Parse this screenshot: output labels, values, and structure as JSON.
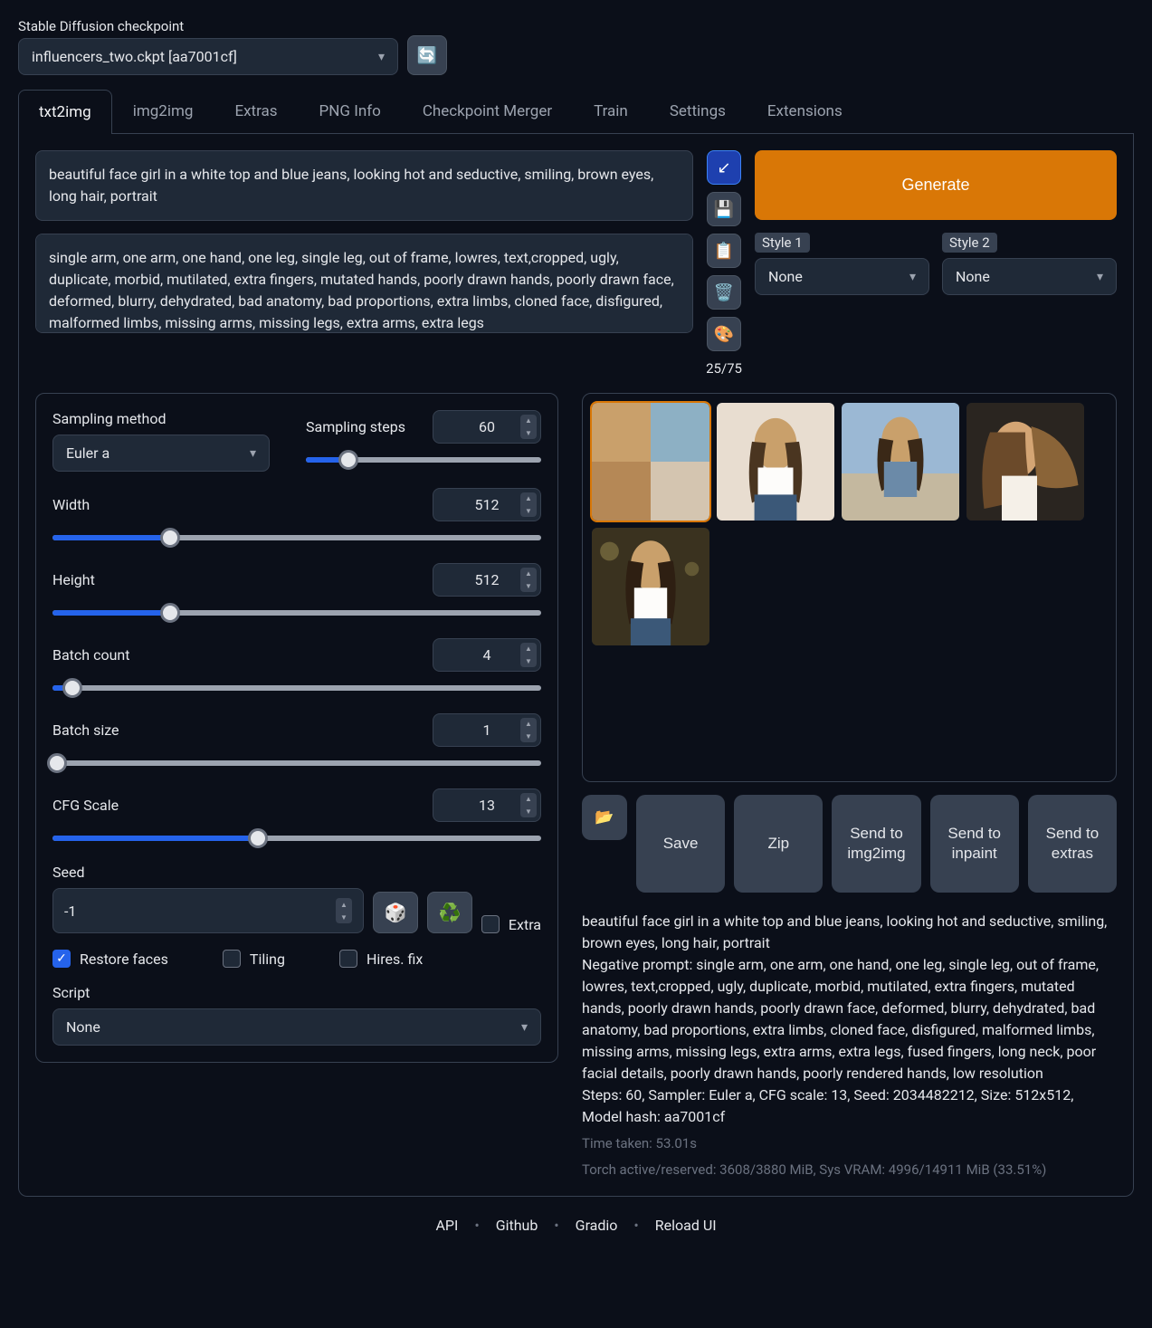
{
  "checkpoint": {
    "label": "Stable Diffusion checkpoint",
    "value": "influencers_two.ckpt [aa7001cf]"
  },
  "tabs": [
    "txt2img",
    "img2img",
    "Extras",
    "PNG Info",
    "Checkpoint Merger",
    "Train",
    "Settings",
    "Extensions"
  ],
  "prompt": "beautiful face girl in a white top and blue jeans, looking hot and seductive, smiling, brown eyes, long hair, portrait",
  "neg_prompt": "single arm, one arm, one hand, one leg, single leg, out of frame, lowres, text,cropped, ugly, duplicate, morbid, mutilated, extra fingers, mutated hands, poorly drawn hands, poorly drawn face, deformed, blurry, dehydrated, bad anatomy, bad proportions, extra limbs, cloned face, disfigured, malformed limbs, missing arms, missing legs, extra arms, extra legs",
  "token_counter": "25/75",
  "generate_label": "Generate",
  "style1": {
    "label": "Style 1",
    "value": "None"
  },
  "style2": {
    "label": "Style 2",
    "value": "None"
  },
  "sampling_method": {
    "label": "Sampling method",
    "value": "Euler a"
  },
  "sampling_steps": {
    "label": "Sampling steps",
    "value": "60",
    "fill": 18
  },
  "width": {
    "label": "Width",
    "value": "512",
    "fill": 24
  },
  "height": {
    "label": "Height",
    "value": "512",
    "fill": 24
  },
  "batch_count": {
    "label": "Batch count",
    "value": "4",
    "fill": 4
  },
  "batch_size": {
    "label": "Batch size",
    "value": "1",
    "fill": 1
  },
  "cfg": {
    "label": "CFG Scale",
    "value": "13",
    "fill": 42
  },
  "seed": {
    "label": "Seed",
    "value": "-1",
    "extra": "Extra"
  },
  "restore_faces": "Restore faces",
  "tiling": "Tiling",
  "hires_fix": "Hires. fix",
  "script": {
    "label": "Script",
    "value": "None"
  },
  "actions": {
    "save": "Save",
    "zip": "Zip",
    "img2img": "Send to img2img",
    "inpaint": "Send to inpaint",
    "extras": "Send to extras"
  },
  "info_prompt": "beautiful face girl in a white top and blue jeans, looking hot and seductive, smiling, brown eyes, long hair, portrait",
  "info_neg": "Negative prompt: single arm, one arm, one hand, one leg, single leg, out of frame, lowres, text,cropped, ugly, duplicate, morbid, mutilated, extra fingers, mutated hands, poorly drawn hands, poorly drawn face, deformed, blurry, dehydrated, bad anatomy, bad proportions, extra limbs, cloned face, disfigured, malformed limbs, missing arms, missing legs, extra arms, extra legs, fused fingers, long neck, poor facial details, poorly drawn hands, poorly rendered hands, low resolution",
  "info_params": "Steps: 60, Sampler: Euler a, CFG scale: 13, Seed: 2034482212, Size: 512x512, Model hash: aa7001cf",
  "info_time": "Time taken: 53.01s",
  "info_vram": "Torch active/reserved: 3608/3880 MiB, Sys VRAM: 4996/14911 MiB (33.51%)",
  "footer": {
    "api": "API",
    "github": "Github",
    "gradio": "Gradio",
    "reload": "Reload UI"
  }
}
